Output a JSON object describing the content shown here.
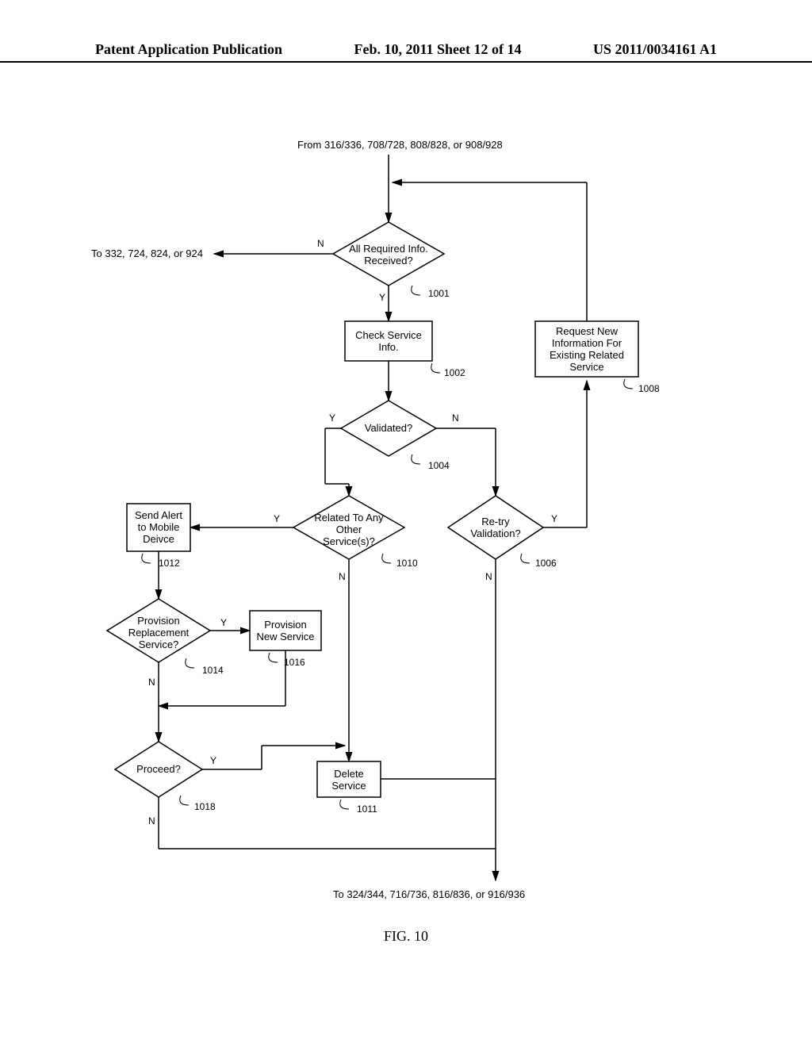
{
  "header": {
    "left": "Patent Application Publication",
    "center": "Feb. 10, 2011  Sheet 12 of 14",
    "right": "US 2011/0034161 A1"
  },
  "figure_caption": "FIG. 10",
  "top_ref": "From 316/336, 708/728, 808/828, or 908/928",
  "left_exit": "To 332, 724, 824, or 924",
  "bottom_ref": "To 324/344, 716/736, 816/836, or 916/936",
  "nodes": {
    "n1001": {
      "text": "All Required Info. Received?",
      "ref": "1001"
    },
    "n1002": {
      "text": "Check Service Info.",
      "ref": "1002"
    },
    "n1004": {
      "text": "Validated?",
      "ref": "1004"
    },
    "n1006": {
      "text": "Re-try Validation?",
      "ref": "1006"
    },
    "n1008": {
      "text": "Request New Information For Existing Related Service",
      "ref": "1008"
    },
    "n1010": {
      "text": "Related To Any Other Service(s)?",
      "ref": "1010"
    },
    "n1011": {
      "text": "Delete Service",
      "ref": "1011"
    },
    "n1012": {
      "text": "Send Alert to Mobile Deivce",
      "ref": "1012"
    },
    "n1014": {
      "text": "Provision Replacement Service?",
      "ref": "1014"
    },
    "n1016": {
      "text": "Provision New Service",
      "ref": "1016"
    },
    "n1018": {
      "text": "Proceed?",
      "ref": "1018"
    }
  },
  "labels": {
    "Y": "Y",
    "N": "N"
  }
}
